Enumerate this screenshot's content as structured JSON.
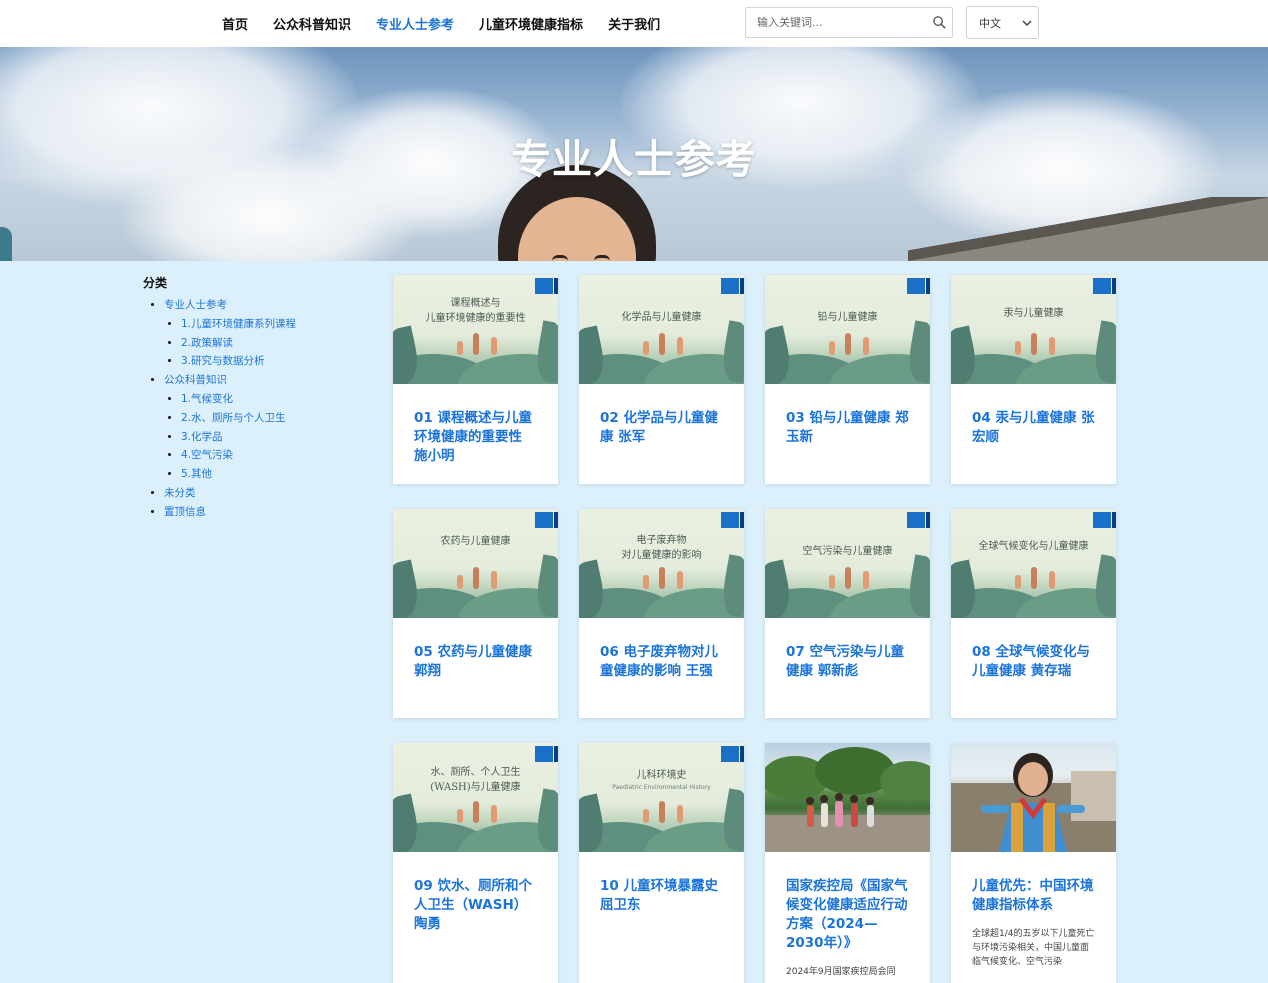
{
  "nav": {
    "items": [
      "首页",
      "公众科普知识",
      "专业人士参考",
      "儿童环境健康指标",
      "关于我们"
    ],
    "active_index": 2
  },
  "search": {
    "placeholder": "输入关键词..."
  },
  "language": {
    "selected": "中文"
  },
  "hero": {
    "title": "专业人士参考"
  },
  "sidebar": {
    "heading": "分类",
    "groups": [
      {
        "label": "专业人士参考",
        "children": [
          "1.儿童环境健康系列课程",
          "2.政策解读",
          "3.研究与数据分析"
        ]
      },
      {
        "label": "公众科普知识",
        "children": [
          "1.气候变化",
          "2.水、厕所与个人卫生",
          "3.化学品",
          "4.空气污染",
          "5.其他"
        ]
      },
      {
        "label": "未分类",
        "children": []
      },
      {
        "label": "置顶信息",
        "children": []
      }
    ]
  },
  "cards": [
    {
      "title": "01 课程概述与儿童环境健康的重要性 施小明",
      "thumb_text": "课程概述与\n儿童环境健康的重要性"
    },
    {
      "title": "02 化学品与儿童健康 张军",
      "thumb_text": "化学品与儿童健康"
    },
    {
      "title": "03 铅与儿童健康 郑玉新",
      "thumb_text": "铅与儿童健康"
    },
    {
      "title": "04 汞与儿童健康 张宏顺",
      "thumb_text": "汞与儿童健康"
    },
    {
      "title": "05 农药与儿童健康 郭翔",
      "thumb_text": "农药与儿童健康"
    },
    {
      "title": "06 电子废弃物对儿童健康的影响 王强",
      "thumb_text": "电子废弃物\n对儿童健康的影响"
    },
    {
      "title": "07 空气污染与儿童健康 郭新彪",
      "thumb_text": "空气污染与儿童健康"
    },
    {
      "title": "08 全球气候变化与儿童健康 黄存瑞",
      "thumb_text": "全球气候变化与儿童健康"
    },
    {
      "title": "09 饮水、厕所和个人卫生（WASH） 陶勇",
      "thumb_text": "水、厕所、个人卫生\n(WASH)与儿童健康"
    },
    {
      "title": "10 儿童环境暴露史 屈卫东",
      "thumb_text": "儿科环境史",
      "thumb_sub": "Paediatric Environmental History"
    },
    {
      "title": "国家疾控局《国家气候变化健康适应行动方案（2024—2030年）》",
      "excerpt": "2024年9月国家疾控局会同"
    },
    {
      "title": "儿童优先：中国环境健康指标体系",
      "excerpt": "全球超1/4的五岁以下儿童死亡与环境污染相关，中国儿童面临气候变化、空气污染"
    }
  ],
  "colors": {
    "accent": "#1c74d8",
    "page_bg": "#dcf0fb",
    "header_bg": "#ffffff"
  },
  "icons": {
    "search": "search-icon",
    "dropdown": "chevron-down-icon"
  }
}
